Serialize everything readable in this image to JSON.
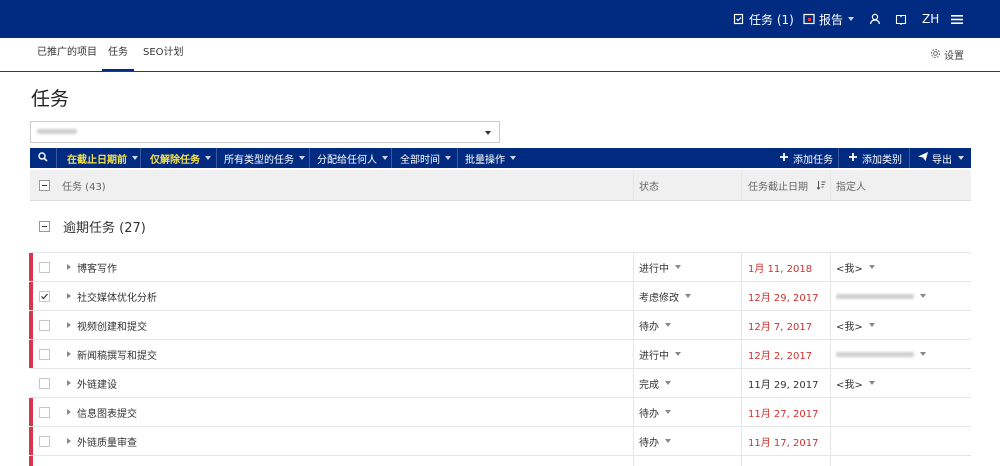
{
  "topbar": {
    "tasks_label": "任务 (1)",
    "reports_label": "报告",
    "lang": "ZH"
  },
  "subnav": {
    "tabs": [
      {
        "label": "已推广的项目"
      },
      {
        "label": "任务"
      },
      {
        "label": "SEO计划"
      }
    ],
    "settings_label": "设置"
  },
  "page": {
    "title": "任务"
  },
  "toolbar": {
    "filters": [
      {
        "label": "在截止日期前"
      },
      {
        "label": "仅解除任务"
      },
      {
        "label": "所有类型的任务"
      },
      {
        "label": "分配给任何人"
      },
      {
        "label": "全部时间"
      },
      {
        "label": "批量操作"
      }
    ],
    "add_task_label": "添加任务",
    "add_category_label": "添加类别",
    "export_label": "导出"
  },
  "table": {
    "headers": {
      "task": "任务 (43)",
      "status": "状态",
      "due": "任务截止日期",
      "assignee": "指定人"
    },
    "group_label": "逾期任务 (27)",
    "rows": [
      {
        "name": "博客写作",
        "status": "进行中",
        "date": "1月 11, 2018",
        "assignee": "<我>",
        "overdue": true
      },
      {
        "name": "社交媒体优化分析",
        "status": "考虑修改",
        "date": "12月 29, 2017",
        "assignee": "",
        "overdue": true
      },
      {
        "name": "视频创建和提交",
        "status": "待办",
        "date": "12月 7, 2017",
        "assignee": "<我>",
        "overdue": true
      },
      {
        "name": "新闻稿撰写和提交",
        "status": "进行中",
        "date": "12月 2, 2017",
        "assignee": "",
        "overdue": true
      },
      {
        "name": "外链建设",
        "status": "完成",
        "date": "11月 29, 2017",
        "assignee": "<我>",
        "overdue": false
      },
      {
        "name": "信息图表提交",
        "status": "待办",
        "date": "11月 27, 2017",
        "assignee": "",
        "overdue": true
      },
      {
        "name": "外链质量审查",
        "status": "待办",
        "date": "11月 17, 2017",
        "assignee": "",
        "overdue": true
      }
    ]
  }
}
